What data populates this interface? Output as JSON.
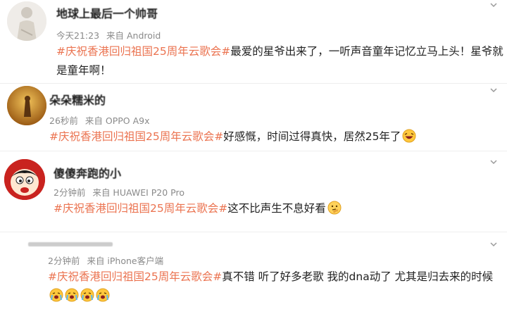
{
  "comments": [
    {
      "username": "地球上最后一个帅哥",
      "time": "今天21:23",
      "source": "来自 Android",
      "hashtag": "#庆祝香港回归祖国25周年云歌会#",
      "text": "最爱的星爷出来了，一听声音童年记忆立马上头！星爷就是童年啊！"
    },
    {
      "username": "朵朵糯米的",
      "time": "26秒前",
      "source": "来自 OPPO A9x",
      "hashtag": "#庆祝香港回归祖国25周年云歌会#",
      "text": "好感慨，时间过得真快，居然25年了"
    },
    {
      "username": "傻傻奔跑的小",
      "time": "2分钟前",
      "source": "来自 HUAWEI P20 Pro",
      "hashtag": "#庆祝香港回归祖国25周年云歌会#",
      "text": "这不比声生不息好看"
    },
    {
      "username": "",
      "time": "2分钟前",
      "source": "来自 iPhone客户端",
      "hashtag": "#庆祝香港回归祖国25周年云歌会#",
      "text": "真不错 听了好多老歌 我的dna动了 尤其是归去来的时候"
    }
  ],
  "colors": {
    "hashtag": "#eb7350",
    "meta": "#8a8a8a",
    "text": "#222222"
  }
}
